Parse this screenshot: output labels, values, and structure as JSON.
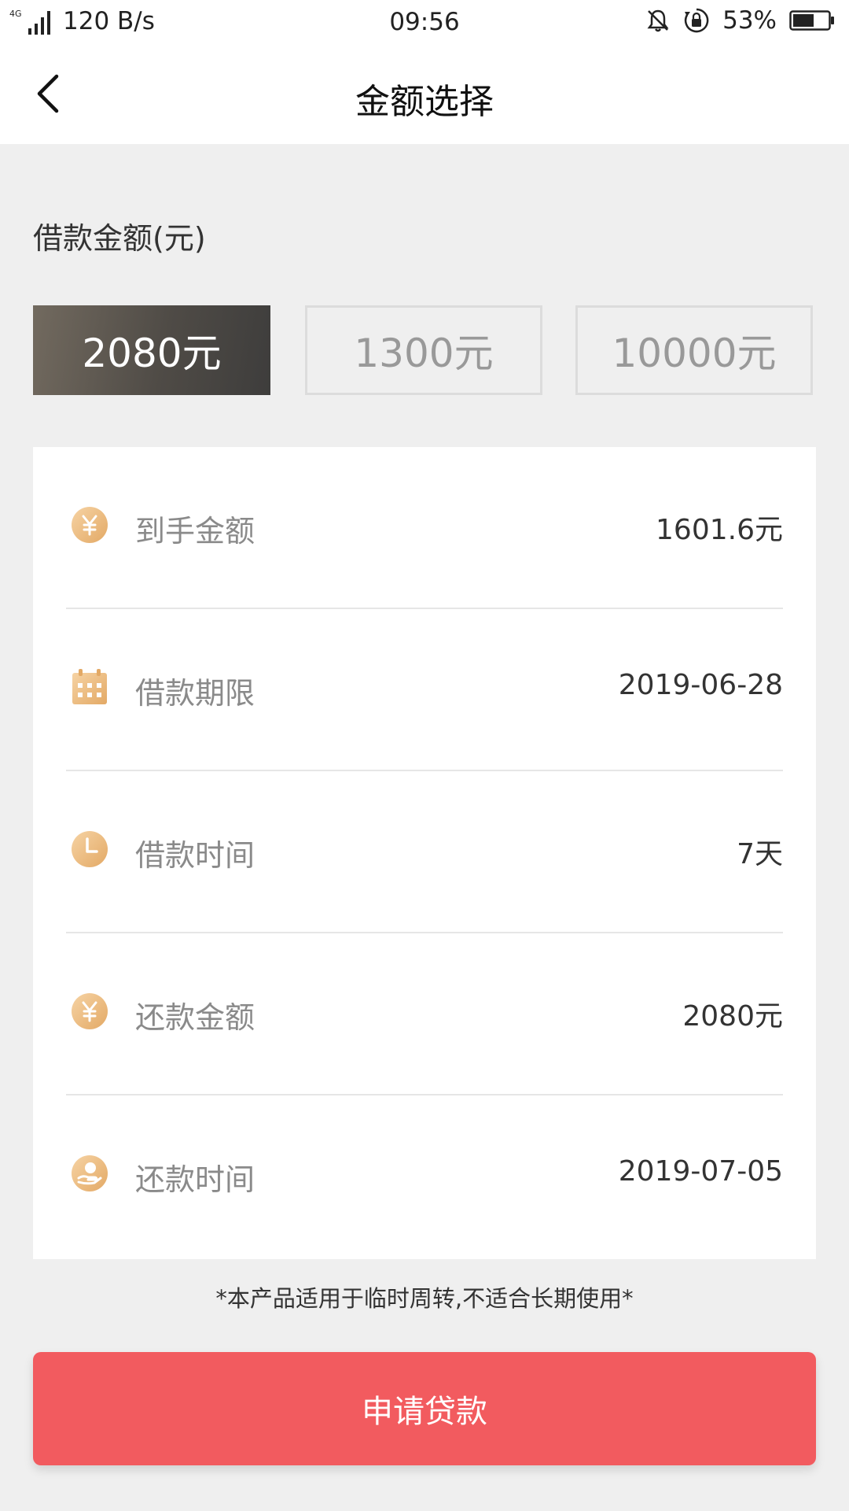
{
  "status_bar": {
    "network_type": "4G",
    "speed": "120 B/s",
    "time": "09:56",
    "battery": "53%"
  },
  "header": {
    "title": "金额选择"
  },
  "amount_section": {
    "label": "借款金额(元)",
    "options": [
      {
        "label": "2080元",
        "selected": true
      },
      {
        "label": "1300元",
        "selected": false
      },
      {
        "label": "10000元",
        "selected": false
      }
    ]
  },
  "details": [
    {
      "icon": "yuan-coin-icon",
      "label": "到手金额",
      "value": "1601.6元"
    },
    {
      "icon": "calendar-icon",
      "label": "借款期限",
      "value": "2019-06-28"
    },
    {
      "icon": "clock-icon",
      "label": "借款时间",
      "value": "7天"
    },
    {
      "icon": "yuan-coin-icon",
      "label": "还款金额",
      "value": "2080元"
    },
    {
      "icon": "repay-hand-icon",
      "label": "还款时间",
      "value": "2019-07-05"
    }
  ],
  "notice": "*本产品适用于临时周转,不适合长期使用*",
  "apply_button": {
    "label": "申请贷款"
  },
  "colors": {
    "accent": "#f25b5f",
    "icon_gold": "#e9b778",
    "selected_dark": "#4f4b46"
  }
}
